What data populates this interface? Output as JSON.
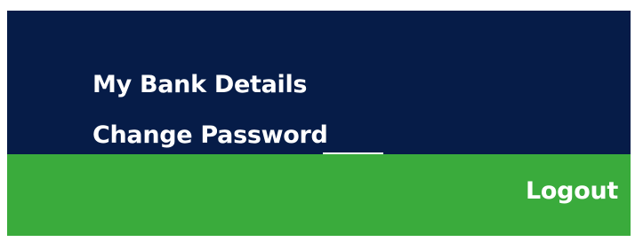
{
  "menu": {
    "items": [
      {
        "label": "My Bank Details"
      },
      {
        "label": "Change Password"
      }
    ]
  },
  "footer": {
    "logout_label": "Logout"
  },
  "colors": {
    "nav_background": "#061c48",
    "footer_background": "#3aab3c",
    "text": "#ffffff"
  }
}
